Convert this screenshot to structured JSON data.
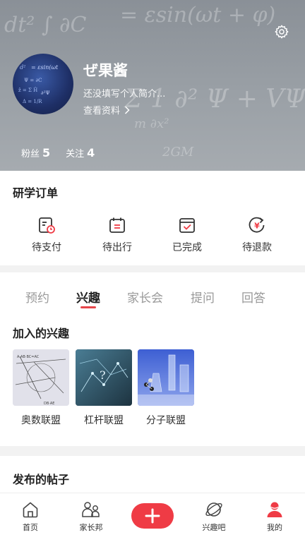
{
  "header": {
    "username": "ぜ果酱",
    "bio": "还没填写个人简介...",
    "view_profile": "查看资料",
    "fans_label": "粉丝",
    "fans_count": "5",
    "follow_label": "关注",
    "follow_count": "4"
  },
  "orders": {
    "title": "研学订单",
    "items": [
      {
        "label": "待支付",
        "icon": "wallet-clock-icon"
      },
      {
        "label": "待出行",
        "icon": "calendar-icon"
      },
      {
        "label": "已完成",
        "icon": "calendar-check-icon"
      },
      {
        "label": "待退款",
        "icon": "refund-icon"
      }
    ]
  },
  "tabs": [
    {
      "label": "预约",
      "active": false
    },
    {
      "label": "兴趣",
      "active": true
    },
    {
      "label": "家长会",
      "active": false
    },
    {
      "label": "提问",
      "active": false
    },
    {
      "label": "回答",
      "active": false
    }
  ],
  "joined": {
    "title": "加入的兴趣",
    "items": [
      {
        "label": "奥数联盟"
      },
      {
        "label": "杠杆联盟"
      },
      {
        "label": "分子联盟"
      }
    ]
  },
  "posts": {
    "title": "发布的帖子"
  },
  "nav": [
    {
      "label": "首页",
      "icon": "home-icon"
    },
    {
      "label": "家长邦",
      "icon": "parents-icon"
    },
    {
      "label": "",
      "icon": "plus-icon"
    },
    {
      "label": "兴趣吧",
      "icon": "planet-icon"
    },
    {
      "label": "我的",
      "icon": "user-icon"
    }
  ],
  "colors": {
    "accent": "#ef3b45",
    "tab_underline": "#e6454a"
  }
}
